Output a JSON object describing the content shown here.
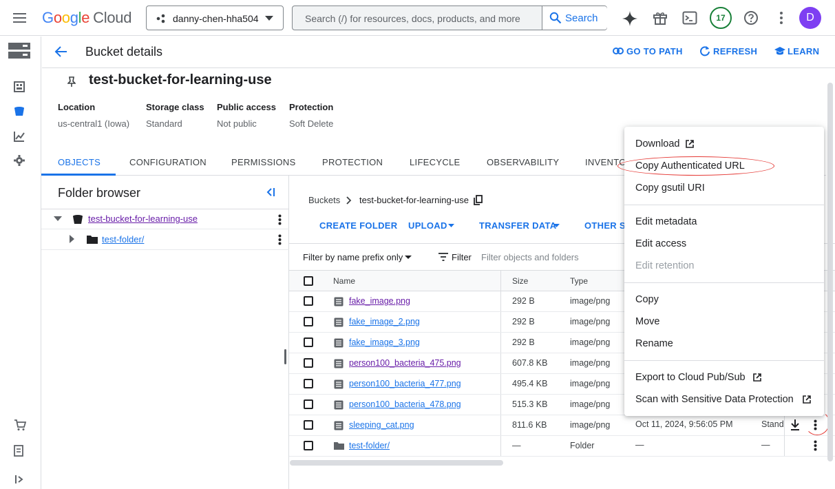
{
  "topbar": {
    "logo_google": [
      "G",
      "o",
      "o",
      "g",
      "l",
      "e"
    ],
    "logo_cloud": "Cloud",
    "project": "danny-chen-hha504",
    "search_placeholder": "Search (/) for resources, docs, products, and more",
    "search_button": "Search",
    "notifications_count": "17",
    "avatar_letter": "D"
  },
  "header": {
    "title": "Bucket details",
    "go_to_path": "GO TO PATH",
    "refresh": "REFRESH",
    "learn": "LEARN"
  },
  "bucket": {
    "name": "test-bucket-for-learning-use",
    "meta": [
      {
        "label": "Location",
        "value": "us-central1 (Iowa)"
      },
      {
        "label": "Storage class",
        "value": "Standard"
      },
      {
        "label": "Public access",
        "value": "Not public"
      },
      {
        "label": "Protection",
        "value": "Soft Delete"
      }
    ]
  },
  "tabs": [
    "OBJECTS",
    "CONFIGURATION",
    "PERMISSIONS",
    "PROTECTION",
    "LIFECYCLE",
    "OBSERVABILITY",
    "INVENTO"
  ],
  "folder_browser": {
    "title": "Folder browser",
    "root": "test-bucket-for-learning-use",
    "child": "test-folder/"
  },
  "objects": {
    "breadcrumb_root": "Buckets",
    "breadcrumb_current": "test-bucket-for-learning-use",
    "actions": [
      "CREATE FOLDER",
      "UPLOAD",
      "TRANSFER DATA",
      "OTHER SE"
    ],
    "filter_mode": "Filter by name prefix only",
    "filter_label": "Filter",
    "filter_placeholder": "Filter objects and folders",
    "columns": {
      "name": "Name",
      "size": "Size",
      "type": "Type"
    },
    "rows": [
      {
        "name": "fake_image.png",
        "size": "292 B",
        "type": "image/png",
        "visited": true
      },
      {
        "name": "fake_image_2.png",
        "size": "292 B",
        "type": "image/png",
        "visited": false
      },
      {
        "name": "fake_image_3.png",
        "size": "292 B",
        "type": "image/png",
        "visited": false
      },
      {
        "name": "person100_bacteria_475.png",
        "size": "607.8 KB",
        "type": "image/png",
        "visited": true
      },
      {
        "name": "person100_bacteria_477.png",
        "size": "495.4 KB",
        "type": "image/png",
        "visited": false
      },
      {
        "name": "person100_bacteria_478.png",
        "size": "515.3 KB",
        "type": "image/png",
        "visited": false
      },
      {
        "name": "sleeping_cat.png",
        "size": "811.6 KB",
        "type": "image/png",
        "visited": false,
        "created": "Oct 11, 2024, 9:56:05 PM",
        "storage": "Stand"
      },
      {
        "name": "test-folder/",
        "size": "—",
        "type": "Folder",
        "visited": false,
        "created": "—",
        "storage": "—",
        "folder": true
      }
    ]
  },
  "context_menu": {
    "download": "Download",
    "copy_auth_url": "Copy Authenticated URL",
    "copy_gsutil": "Copy gsutil URI",
    "edit_metadata": "Edit metadata",
    "edit_access": "Edit access",
    "edit_retention": "Edit retention",
    "copy": "Copy",
    "move": "Move",
    "rename": "Rename",
    "export_pubsub": "Export to Cloud Pub/Sub",
    "scan_sdp": "Scan with Sensitive Data Protection"
  }
}
